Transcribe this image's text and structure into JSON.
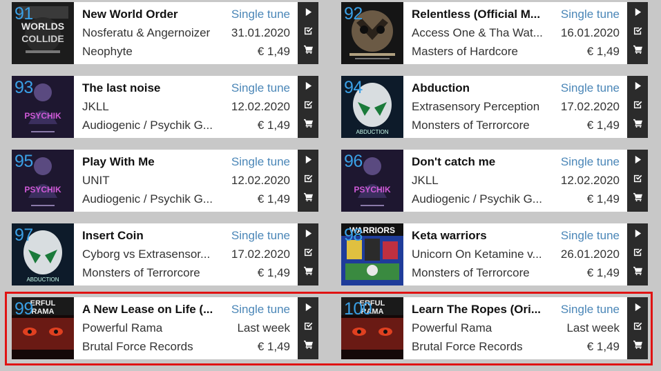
{
  "tracks": [
    {
      "rank": "91",
      "title": "New World Order",
      "type": "Single tune",
      "artist": "Nosferatu & Angernoizer",
      "date": "31.01.2020",
      "label": "Neophyte",
      "price": "€ 1,49",
      "cover": "dark-collage",
      "cover_text": "WORLDS COLLIDE"
    },
    {
      "rank": "92",
      "title": "Relentless (Official M...",
      "type": "Single tune",
      "artist": "Access One & Tha Wat...",
      "date": "16.01.2020",
      "label": "Masters of Hardcore",
      "price": "€ 1,49",
      "cover": "skull-mask",
      "cover_text": ""
    },
    {
      "rank": "93",
      "title": "The last noise",
      "type": "Single tune",
      "artist": "JKLL",
      "date": "12.02.2020",
      "label": "Audiogenic / Psychik G...",
      "price": "€ 1,49",
      "cover": "purple-figure",
      "cover_text": "PSYCHIK"
    },
    {
      "rank": "94",
      "title": "Abduction",
      "type": "Single tune",
      "artist": "Extrasensory Perception",
      "date": "17.02.2020",
      "label": "Monsters of Terrorcore",
      "price": "€ 1,49",
      "cover": "alien-head",
      "cover_text": "ABDUCTION"
    },
    {
      "rank": "95",
      "title": "Play With Me",
      "type": "Single tune",
      "artist": "UNIT",
      "date": "12.02.2020",
      "label": "Audiogenic / Psychik G...",
      "price": "€ 1,49",
      "cover": "purple-figure",
      "cover_text": "PSYCHIK"
    },
    {
      "rank": "96",
      "title": "Don't catch me",
      "type": "Single tune",
      "artist": "JKLL",
      "date": "12.02.2020",
      "label": "Audiogenic / Psychik G...",
      "price": "€ 1,49",
      "cover": "purple-figure",
      "cover_text": "PSYCHIK"
    },
    {
      "rank": "97",
      "title": "Insert Coin",
      "type": "Single tune",
      "artist": "Cyborg vs Extrasensor...",
      "date": "17.02.2020",
      "label": "Monsters of Terrorcore",
      "price": "€ 1,49",
      "cover": "alien-head",
      "cover_text": "ABDUCTION"
    },
    {
      "rank": "98",
      "title": "Keta warriors",
      "type": "Single tune",
      "artist": "Unicorn On Ketamine v...",
      "date": "26.01.2020",
      "label": "Monsters of Terrorcore",
      "price": "€ 1,49",
      "cover": "colorful-collage",
      "cover_text": "WARRIORS"
    },
    {
      "rank": "99",
      "title": "A New Lease on Life (...",
      "type": "Single tune",
      "artist": "Powerful Rama",
      "date": "Last week",
      "label": "Brutal Force Records",
      "price": "€ 1,49",
      "cover": "red-eyes",
      "cover_text": "ERFUL RAMA"
    },
    {
      "rank": "100",
      "title": "Learn The Ropes (Ori...",
      "type": "Single tune",
      "artist": "Powerful Rama",
      "date": "Last week",
      "label": "Brutal Force Records",
      "price": "€ 1,49",
      "cover": "red-eyes",
      "cover_text": "ERFUL RAMA"
    }
  ],
  "actions": {
    "play": "play-icon",
    "add": "checklist-icon",
    "cart": "cart-icon"
  },
  "colors": {
    "rank": "#3aa0e6",
    "type": "#4a86b7",
    "action_bg": "#2b2b2b",
    "highlight": "#e01313",
    "page_bg": "#c8c8c8"
  }
}
